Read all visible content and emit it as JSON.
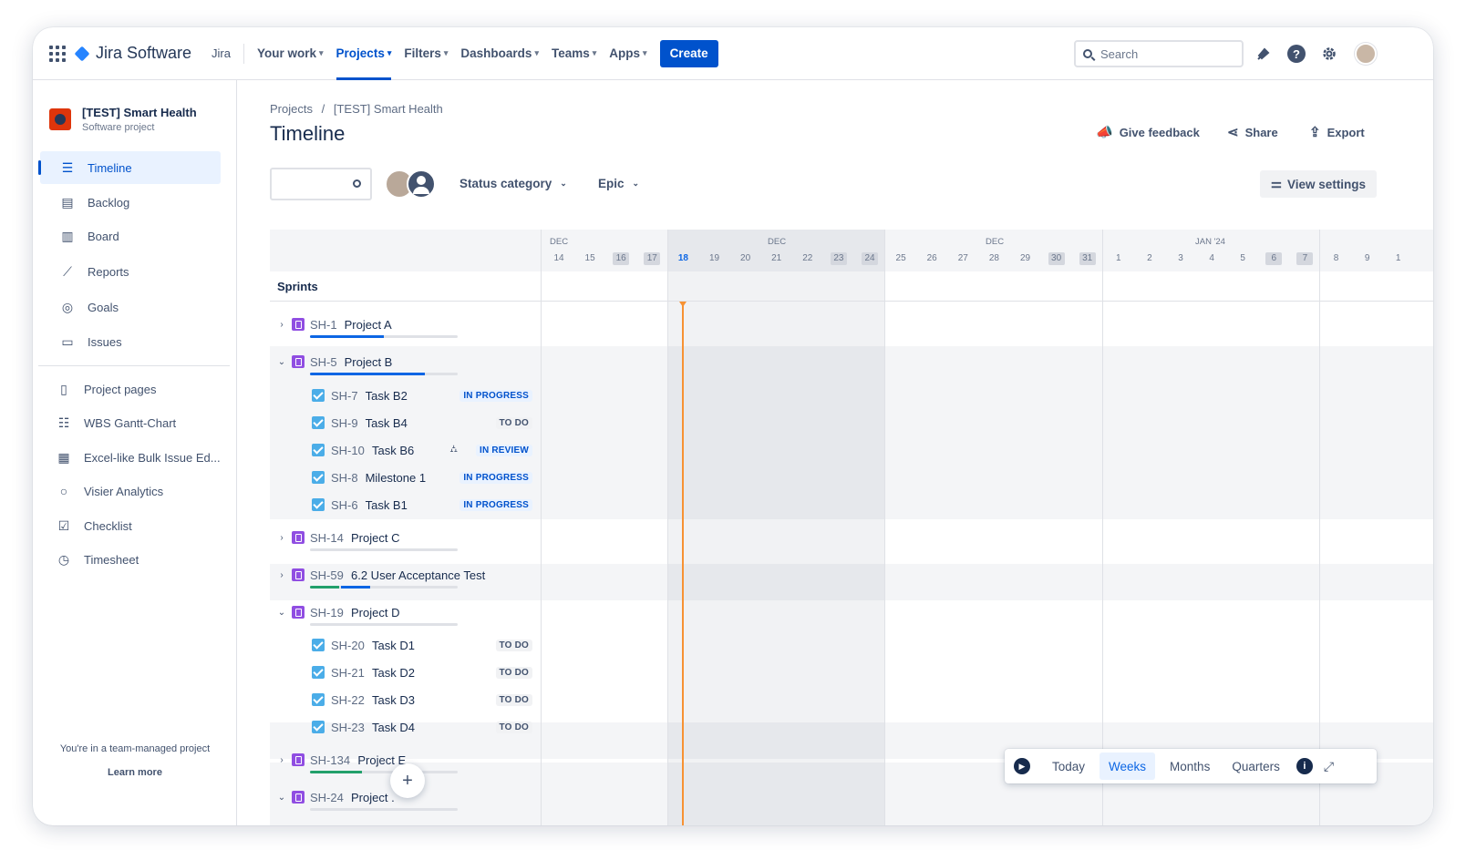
{
  "topnav": {
    "brand": "Jira Software",
    "product": "Jira",
    "items": [
      {
        "label": "Your work"
      },
      {
        "label": "Projects"
      },
      {
        "label": "Filters"
      },
      {
        "label": "Dashboards"
      },
      {
        "label": "Teams"
      },
      {
        "label": "Apps"
      }
    ],
    "active_item": "Projects",
    "create_label": "Create",
    "search_placeholder": "Search",
    "icons": [
      "app-switcher-icon",
      "notification-icon",
      "help-icon",
      "settings-icon",
      "user-avatar"
    ]
  },
  "sidebar": {
    "project_name": "[TEST] Smart Health",
    "project_type": "Software project",
    "items": [
      {
        "label": "Timeline",
        "icon": "timeline-icon"
      },
      {
        "label": "Backlog",
        "icon": "backlog-icon"
      },
      {
        "label": "Board",
        "icon": "board-icon"
      },
      {
        "label": "Reports",
        "icon": "reports-icon"
      },
      {
        "label": "Goals",
        "icon": "goals-icon"
      },
      {
        "label": "Issues",
        "icon": "issues-icon"
      }
    ],
    "apps": [
      {
        "label": "Project pages",
        "icon": "page-icon"
      },
      {
        "label": "WBS Gantt-Chart",
        "icon": "gantt-icon"
      },
      {
        "label": "Excel-like Bulk Issue Ed...",
        "icon": "spreadsheet-icon"
      },
      {
        "label": "Visier Analytics",
        "icon": "circle-icon"
      },
      {
        "label": "Checklist",
        "icon": "checklist-icon"
      },
      {
        "label": "Timesheet",
        "icon": "clock-icon"
      }
    ],
    "team_info": "You're in a team-managed project",
    "learn_more": "Learn more"
  },
  "main": {
    "breadcrumb": [
      "Projects",
      "[TEST] Smart Health"
    ],
    "breadcrumb_sep": "/",
    "title": "Timeline",
    "actions": [
      {
        "label": "Give feedback",
        "icon": "megaphone-icon"
      },
      {
        "label": "Share",
        "icon": "share-icon"
      },
      {
        "label": "Export",
        "icon": "export-icon"
      }
    ],
    "filters": {
      "status_category": "Status category",
      "epic": "Epic",
      "view_settings": "View settings"
    }
  },
  "timeline": {
    "months": [
      "DEC",
      "DEC",
      "DEC",
      "JAN '24"
    ],
    "days": [
      "14",
      "15",
      "16",
      "17",
      "18",
      "19",
      "20",
      "21",
      "22",
      "23",
      "24",
      "25",
      "26",
      "27",
      "28",
      "29",
      "30",
      "31",
      "1",
      "2",
      "3",
      "4",
      "5",
      "6",
      "7",
      "8",
      "9",
      "1"
    ],
    "weekend_days": [
      "16",
      "17",
      "23",
      "24",
      "30",
      "31",
      "6",
      "7"
    ],
    "today": "18",
    "sprints_label": "Sprints",
    "rows": [
      {
        "type": "epic",
        "toggle": "›",
        "key": "SH-1",
        "name": "Project A",
        "progress": 0.5,
        "progress_done": 0
      },
      {
        "type": "epic",
        "toggle": "⌄",
        "key": "SH-5",
        "name": "Project B",
        "progress": 0.78,
        "progress_done": 0
      },
      {
        "type": "task",
        "key": "SH-7",
        "name": "Task B2",
        "status": "IN PROGRESS"
      },
      {
        "type": "task",
        "key": "SH-9",
        "name": "Task B4",
        "status": "TO DO"
      },
      {
        "type": "task",
        "key": "SH-10",
        "name": "Task B6",
        "status": "IN REVIEW",
        "child_icon": true
      },
      {
        "type": "task",
        "key": "SH-8",
        "name": "Milestone 1",
        "status": "IN PROGRESS"
      },
      {
        "type": "task",
        "key": "SH-6",
        "name": "Task B1",
        "status": "IN PROGRESS"
      },
      {
        "type": "epic",
        "toggle": "›",
        "key": "SH-14",
        "name": "Project C",
        "progress": 0,
        "progress_done": 0
      },
      {
        "type": "epic",
        "toggle": "›",
        "key": "SH-59",
        "name": "6.2 User Acceptance Test",
        "progress": 0.4,
        "progress_done": 0.2
      },
      {
        "type": "epic",
        "toggle": "⌄",
        "key": "SH-19",
        "name": "Project D",
        "progress": 0,
        "progress_done": 0
      },
      {
        "type": "task",
        "key": "SH-20",
        "name": "Task D1",
        "status": "TO DO"
      },
      {
        "type": "task",
        "key": "SH-21",
        "name": "Task D2",
        "status": "TO DO"
      },
      {
        "type": "task",
        "key": "SH-22",
        "name": "Task D3",
        "status": "TO DO"
      },
      {
        "type": "task",
        "key": "SH-23",
        "name": "Task D4",
        "status": "TO DO"
      },
      {
        "type": "epic",
        "toggle": "›",
        "key": "SH-134",
        "name": "Project E",
        "progress": 0.35,
        "progress_done": 0.35
      },
      {
        "type": "epic",
        "toggle": "⌄",
        "key": "SH-24",
        "name": "Project .",
        "progress": 0,
        "progress_done": 0
      }
    ]
  },
  "controls": {
    "today": "Today",
    "weeks": "Weeks",
    "months": "Months",
    "quarters": "Quarters",
    "selected": "Weeks",
    "add": "+"
  },
  "colors": {
    "accent": "#0052cc",
    "today_line": "#f79233",
    "epic": "#904ee2",
    "task": "#4bade8"
  }
}
